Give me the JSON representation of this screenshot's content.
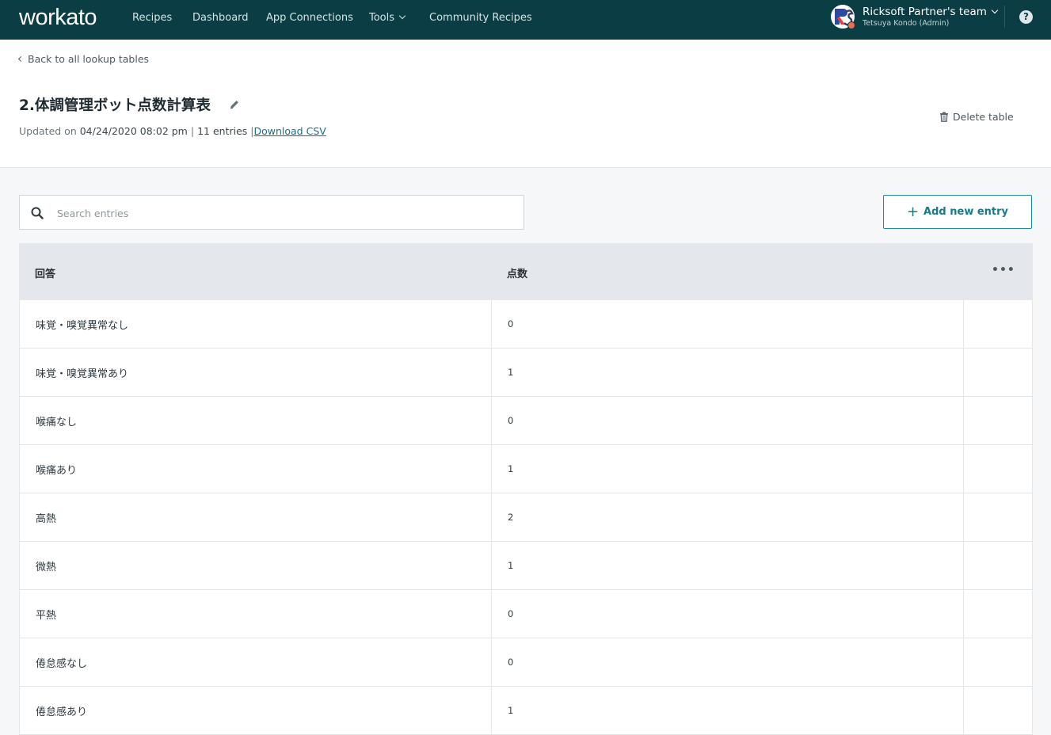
{
  "nav": {
    "logo": "workato",
    "items": [
      "Recipes",
      "Dashboard",
      "App Connections",
      "Tools",
      "Community Recipes"
    ],
    "team_name": "Ricksoft Partner's team",
    "team_user": "Tetsuya Kondo (Admin)",
    "help_label": "?"
  },
  "header": {
    "back_label": "Back to all lookup tables",
    "title": "2.体調管理ボット点数計算表",
    "updated_prefix": "Updated on",
    "updated_at": "04/24/2020 08:02 pm",
    "entries": "11 entries",
    "download_label": "Download CSV",
    "delete_label": "Delete table"
  },
  "search": {
    "placeholder": "Search entries",
    "value": ""
  },
  "add_button": {
    "label": "Add new entry"
  },
  "table": {
    "columns": [
      "回答",
      "点数"
    ],
    "more_label": "•••",
    "rows": [
      [
        "味覚・嗅覚異常なし",
        "0"
      ],
      [
        "味覚・嗅覚異常あり",
        "1"
      ],
      [
        "喉痛なし",
        "0"
      ],
      [
        "喉痛あり",
        "1"
      ],
      [
        "高熱",
        "2"
      ],
      [
        "微熱",
        "1"
      ],
      [
        "平熱",
        "0"
      ],
      [
        "倦怠感なし",
        "0"
      ],
      [
        "倦怠感あり",
        "1"
      ]
    ]
  },
  "colors": {
    "nav_bg": "#0a3e44",
    "accent": "#1f8a9c",
    "header_row": "#e4e7eb",
    "avatar_dot": "#f26b4a"
  }
}
